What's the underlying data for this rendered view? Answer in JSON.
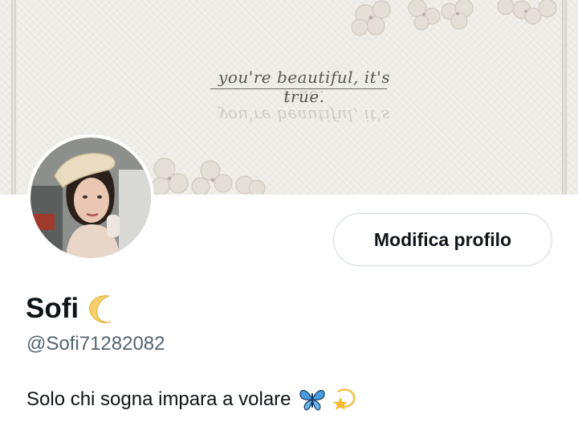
{
  "banner": {
    "quote": "you're beautiful, it's true."
  },
  "profile": {
    "display_name": "Sofi",
    "name_emoji": "crescent-moon-icon",
    "handle": "@Sofi71282082",
    "bio": "Solo chi sogna impara a volare",
    "bio_emojis": [
      "butterfly-icon",
      "dizzy-star-icon"
    ]
  },
  "actions": {
    "edit_profile_label": "Modifica profilo"
  },
  "colors": {
    "text_primary": "#0f1419",
    "text_secondary": "#536471",
    "button_border": "#cfd9de",
    "banner_bg": "#f1efe9"
  }
}
